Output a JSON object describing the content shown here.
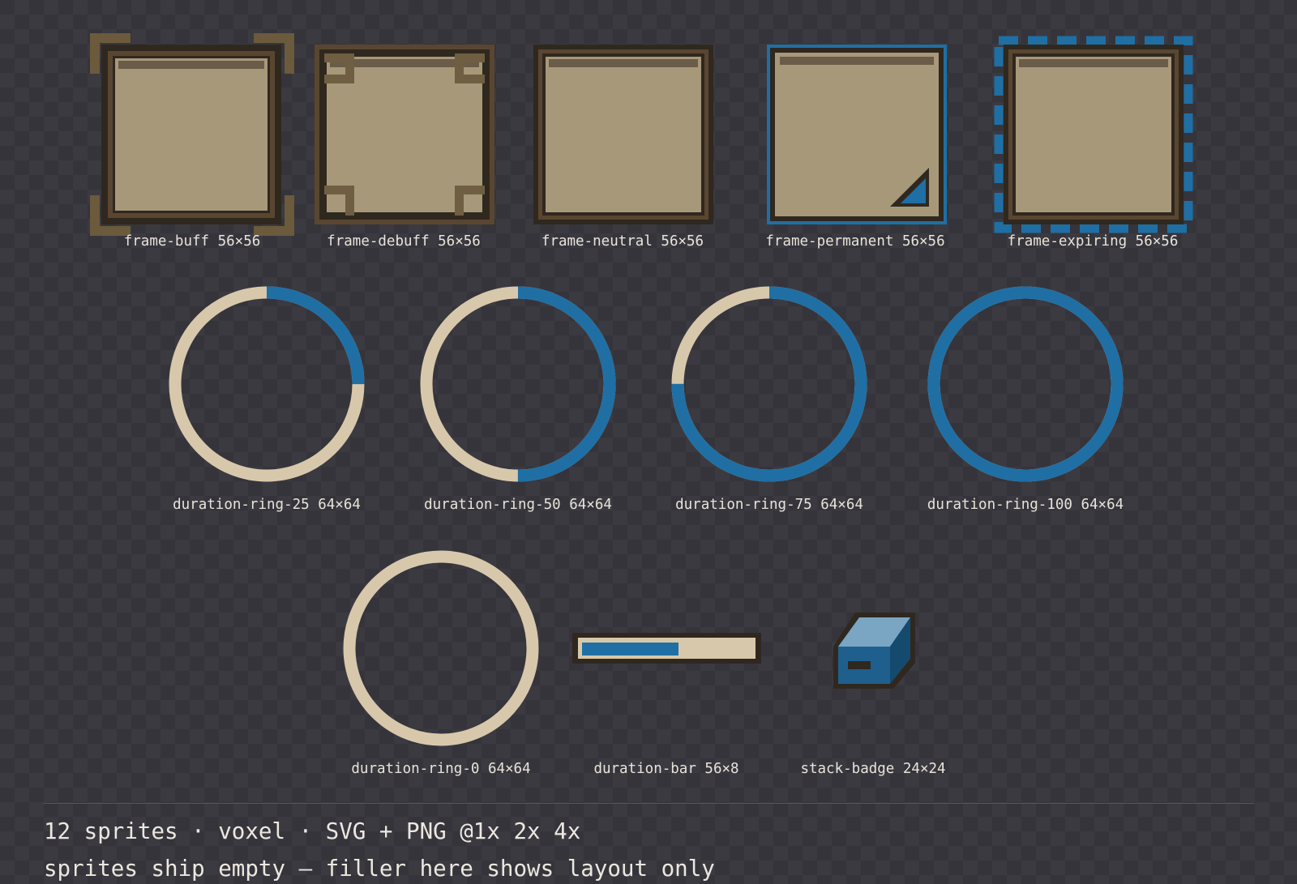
{
  "colors": {
    "background": "#35343b",
    "frame_dark": "#2f281f",
    "frame_brown": "#5a4630",
    "fill_tan": "#a8987a",
    "bar_top": "#6a5c49",
    "buff_bracket": "#6b5a3c",
    "debuff_bracket": "#6f5e42",
    "blue": "#1f6fa4",
    "ring_track": "#d8c8ab",
    "badge_light": "#7aa6c4",
    "badge_mid": "#1e5f8e",
    "badge_dark": "#154a6f",
    "text": "#e8e4da"
  },
  "sprites": {
    "frame_buff": {
      "label": "frame-buff 56×56",
      "icon": "frame-buff-icon"
    },
    "frame_debuff": {
      "label": "frame-debuff 56×56",
      "icon": "frame-debuff-icon"
    },
    "frame_neutral": {
      "label": "frame-neutral 56×56",
      "icon": "frame-neutral-icon"
    },
    "frame_permanent": {
      "label": "frame-permanent 56×56",
      "icon": "frame-permanent-icon"
    },
    "frame_expiring": {
      "label": "frame-expiring 56×56",
      "icon": "frame-expiring-icon"
    },
    "ring_25": {
      "label": "duration-ring-25 64×64",
      "progress": 0.25,
      "icon": "duration-ring-icon"
    },
    "ring_50": {
      "label": "duration-ring-50 64×64",
      "progress": 0.5,
      "icon": "duration-ring-icon"
    },
    "ring_75": {
      "label": "duration-ring-75 64×64",
      "progress": 0.75,
      "icon": "duration-ring-icon"
    },
    "ring_100": {
      "label": "duration-ring-100 64×64",
      "progress": 1.0,
      "icon": "duration-ring-icon"
    },
    "ring_0": {
      "label": "duration-ring-0 64×64",
      "progress": 0.0,
      "icon": "duration-ring-icon"
    },
    "bar": {
      "label": "duration-bar 56×8",
      "progress": 0.57,
      "icon": "duration-bar-icon"
    },
    "badge": {
      "label": "stack-badge 24×24",
      "icon": "stack-badge-icon"
    }
  },
  "footer": {
    "line1": "12 sprites · voxel · SVG + PNG @1x 2x 4x",
    "line2": "sprites ship empty — filler here shows layout only"
  }
}
